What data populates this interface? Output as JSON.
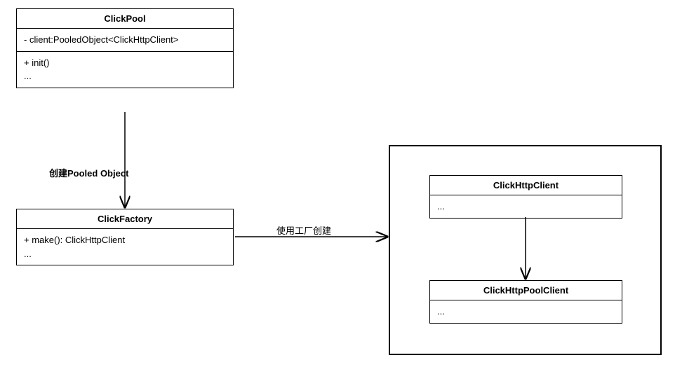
{
  "classes": {
    "clickPool": {
      "name": "ClickPool",
      "attributes": "- client:PooledObject<ClickHttpClient>",
      "methods": "+ init()\n..."
    },
    "clickFactory": {
      "name": "ClickFactory",
      "methods": "+ make(): ClickHttpClient\n..."
    },
    "clickHttpClient": {
      "name": "ClickHttpClient",
      "body": "..."
    },
    "clickHttpPoolClient": {
      "name": "ClickHttpPoolClient",
      "body": "..."
    }
  },
  "labels": {
    "createPooled": "创建Pooled Object",
    "useFactory": "使用工厂创建"
  }
}
